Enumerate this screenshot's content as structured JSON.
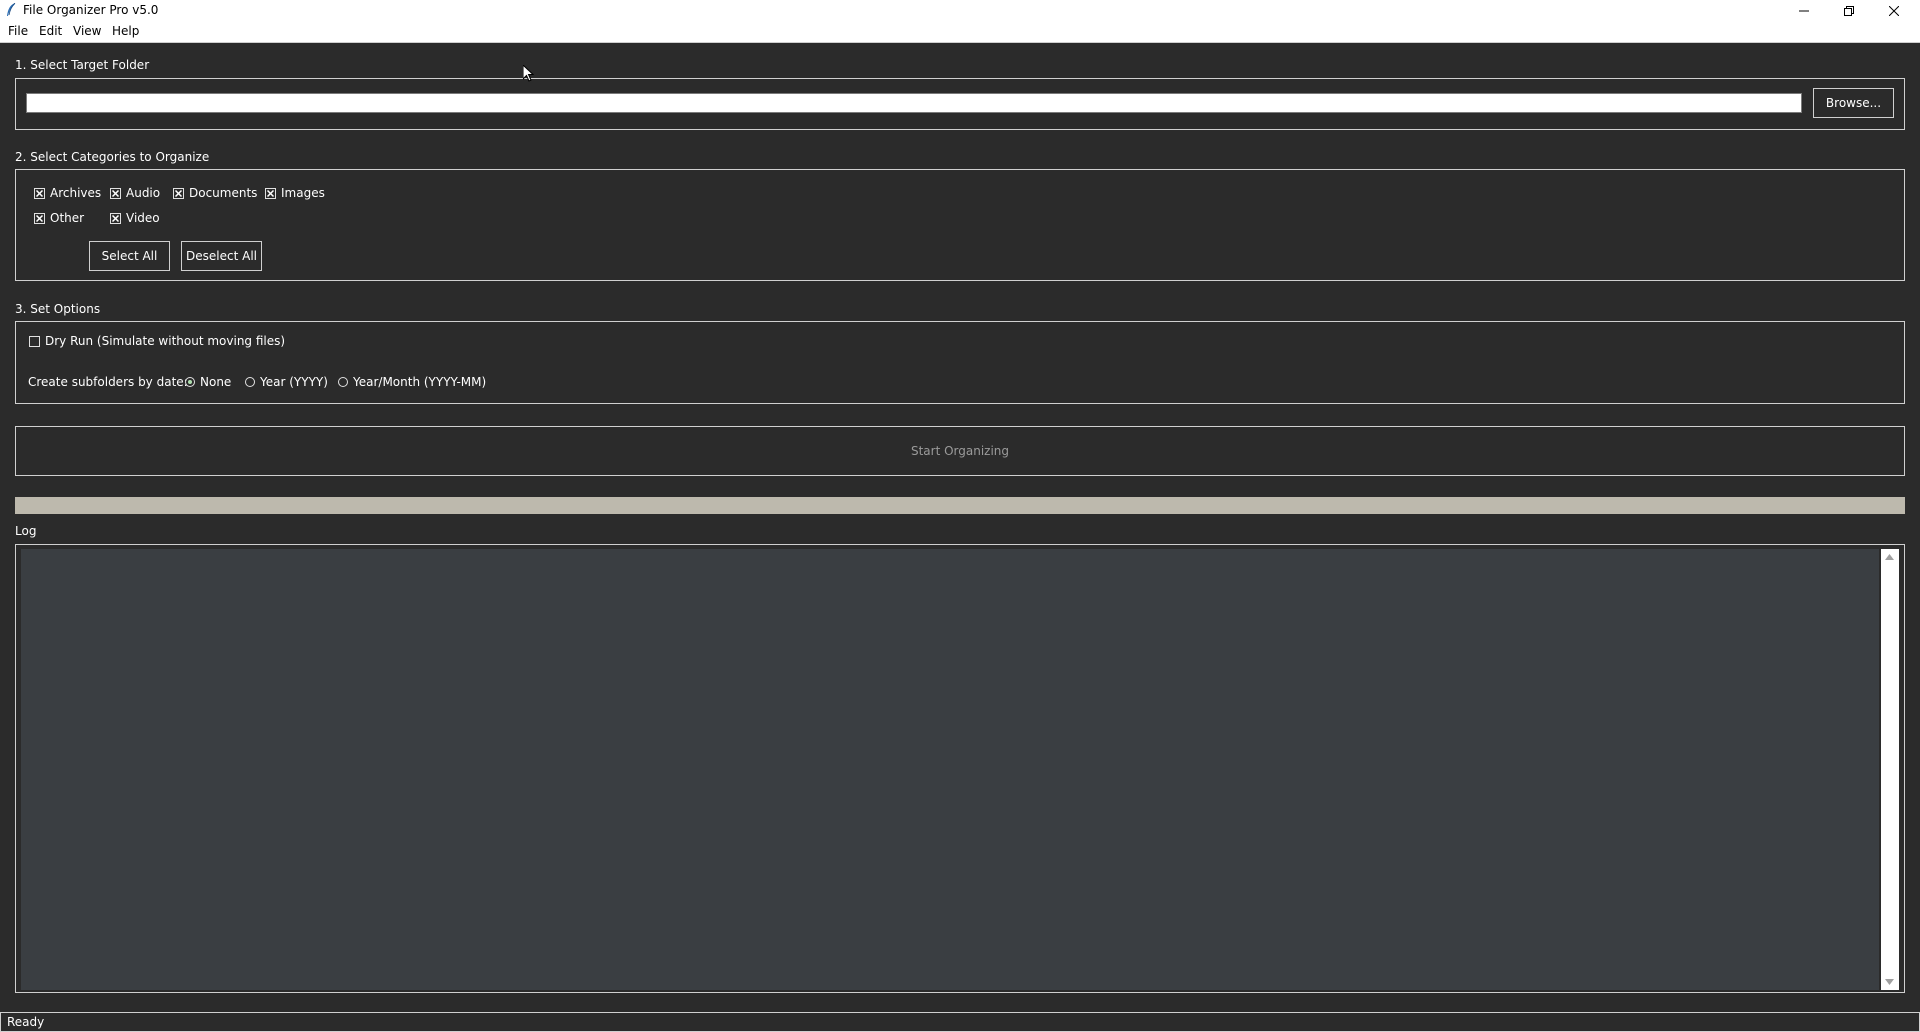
{
  "window": {
    "title": "File Organizer Pro v5.0",
    "icon": "feather-icon"
  },
  "menubar": {
    "items": [
      "File",
      "Edit",
      "View",
      "Help"
    ]
  },
  "target_folder": {
    "label": "1. Select Target Folder",
    "path_value": "",
    "browse_label": "Browse..."
  },
  "categories": {
    "label": "2. Select Categories to Organize",
    "items": [
      {
        "label": "Archives",
        "checked": true
      },
      {
        "label": "Audio",
        "checked": true
      },
      {
        "label": "Documents",
        "checked": true
      },
      {
        "label": "Images",
        "checked": true
      },
      {
        "label": "Other",
        "checked": true
      },
      {
        "label": "Video",
        "checked": true
      }
    ],
    "select_all_label": "Select All",
    "deselect_all_label": "Deselect All"
  },
  "options": {
    "label": "3. Set Options",
    "dry_run_label": "Dry Run (Simulate without moving files)",
    "dry_run_checked": false,
    "subfolders_label": "Create subfolders by date:",
    "date_modes": [
      {
        "label": "None",
        "selected": true
      },
      {
        "label": "Year (YYYY)",
        "selected": false
      },
      {
        "label": "Year/Month (YYYY-MM)",
        "selected": false
      }
    ]
  },
  "start_button_label": "Start Organizing",
  "progress": {
    "value": 0
  },
  "log": {
    "label": "Log",
    "content": ""
  },
  "status": {
    "text": "Ready"
  },
  "colors": {
    "background": "#2b2b2b",
    "log_background": "#3a3e42",
    "progress_trough": "#bdb9ad",
    "disabled_text": "#9a9a9a"
  }
}
